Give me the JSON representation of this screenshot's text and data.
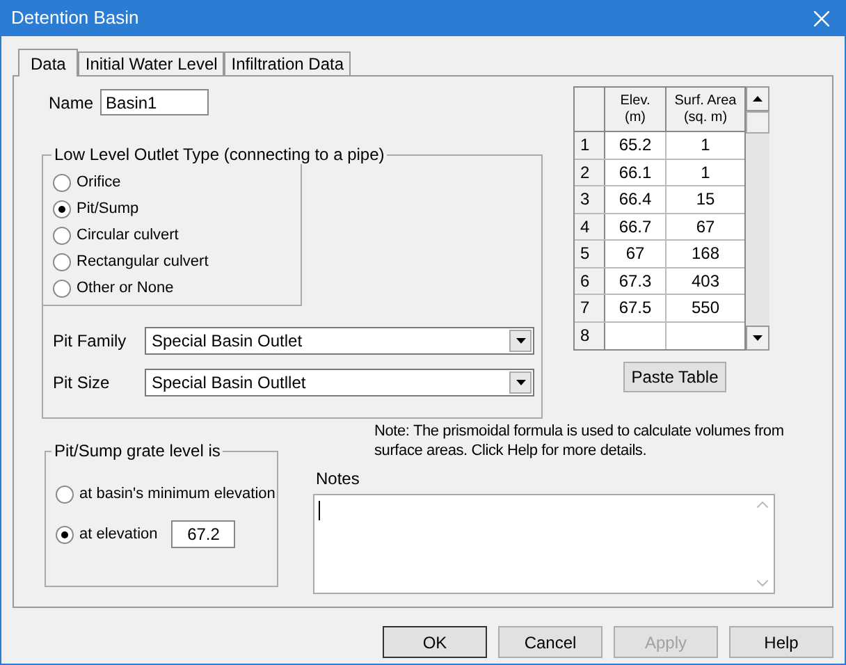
{
  "window": {
    "title": "Detention Basin"
  },
  "tabs": [
    {
      "label": "Data",
      "selected": true
    },
    {
      "label": "Initial Water Level",
      "selected": false
    },
    {
      "label": "Infiltration Data",
      "selected": false
    }
  ],
  "name": {
    "label": "Name",
    "value": "Basin1"
  },
  "outlet_type": {
    "legend": "Low Level Outlet Type (connecting to a pipe)",
    "options": [
      {
        "label": "Orifice",
        "selected": false
      },
      {
        "label": "Pit/Sump",
        "selected": true
      },
      {
        "label": "Circular culvert",
        "selected": false
      },
      {
        "label": "Rectangular culvert",
        "selected": false
      },
      {
        "label": "Other or None",
        "selected": false
      }
    ],
    "pit_family": {
      "label": "Pit Family",
      "value": "Special Basin Outlet"
    },
    "pit_size": {
      "label": "Pit Size",
      "value": "Special Basin Outllet"
    }
  },
  "table": {
    "columns": [
      "Elev.\n(m)",
      "Surf. Area\n(sq. m)"
    ],
    "rows": [
      {
        "index": "1",
        "cells": [
          "65.2",
          "1"
        ]
      },
      {
        "index": "2",
        "cells": [
          "66.1",
          "1"
        ]
      },
      {
        "index": "3",
        "cells": [
          "66.4",
          "15"
        ]
      },
      {
        "index": "4",
        "cells": [
          "66.7",
          "67"
        ]
      },
      {
        "index": "5",
        "cells": [
          "67",
          "168"
        ]
      },
      {
        "index": "6",
        "cells": [
          "67.3",
          "403"
        ]
      },
      {
        "index": "7",
        "cells": [
          "67.5",
          "550"
        ]
      },
      {
        "index": "8",
        "cells": [
          "",
          ""
        ]
      }
    ]
  },
  "paste_button": "Paste Table",
  "note": "Note: The prismoidal formula is used to calculate volumes from surface areas.  Click Help for more details.",
  "grate_level": {
    "legend": "Pit/Sump grate level is",
    "options": [
      {
        "label": "at basin's minimum elevation",
        "selected": false
      },
      {
        "label": "at elevation",
        "selected": true,
        "value": "67.2"
      }
    ]
  },
  "notes": {
    "label": "Notes"
  },
  "buttons": [
    {
      "label": "OK",
      "disabled": false
    },
    {
      "label": "Cancel",
      "disabled": false
    },
    {
      "label": "Apply",
      "disabled": true
    },
    {
      "label": "Help",
      "disabled": false
    }
  ]
}
